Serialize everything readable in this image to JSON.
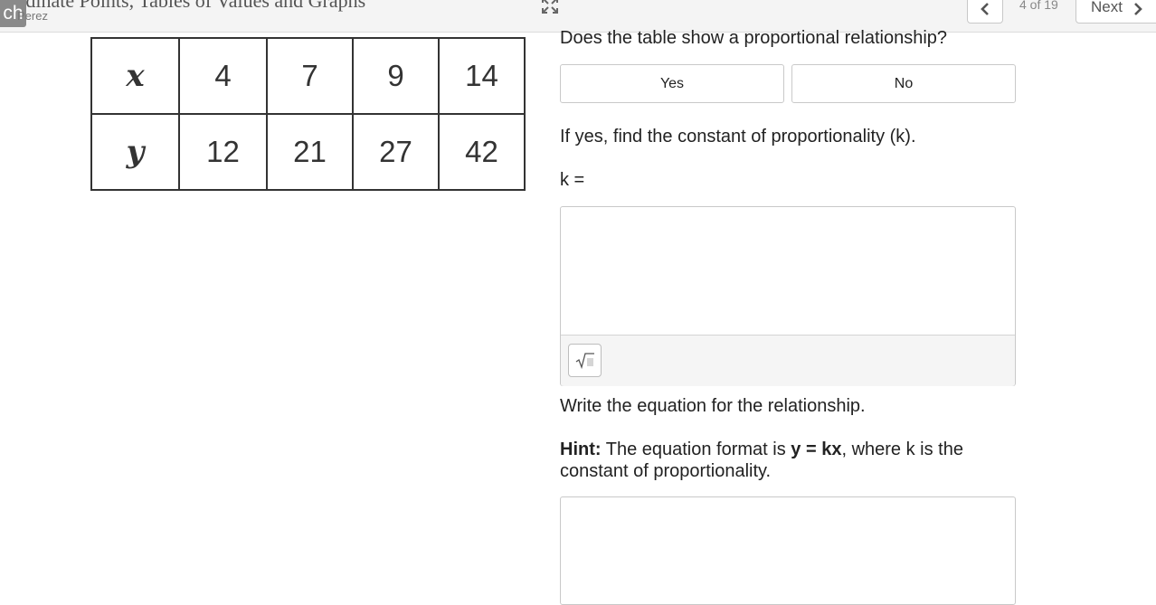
{
  "header": {
    "title": "ordinate Points, Tables of Values and Graphs",
    "app_badge": "ch",
    "author": "Perez",
    "page_counter": "4 of 19",
    "next_label": "Next"
  },
  "table": {
    "rows": [
      [
        "x",
        "4",
        "7",
        "9",
        "14"
      ],
      [
        "y",
        "12",
        "21",
        "27",
        "42"
      ]
    ]
  },
  "question1": {
    "prompt": "Does the table show a proportional relationship?",
    "options": [
      "Yes",
      "No"
    ]
  },
  "question2": {
    "prompt": "If yes, find the constant of proportionality (k).",
    "k_label": "k ="
  },
  "question3": {
    "prompt": "Write the equation for the relationship.",
    "hint_label": "Hint:",
    "hint_text_1": " The equation format is ",
    "hint_formula": "y = kx",
    "hint_text_2": ", where k is the constant of proportionality."
  },
  "icons": [
    "expand-icon",
    "chevron-left-icon",
    "chevron-right-icon",
    "square-root-icon"
  ]
}
